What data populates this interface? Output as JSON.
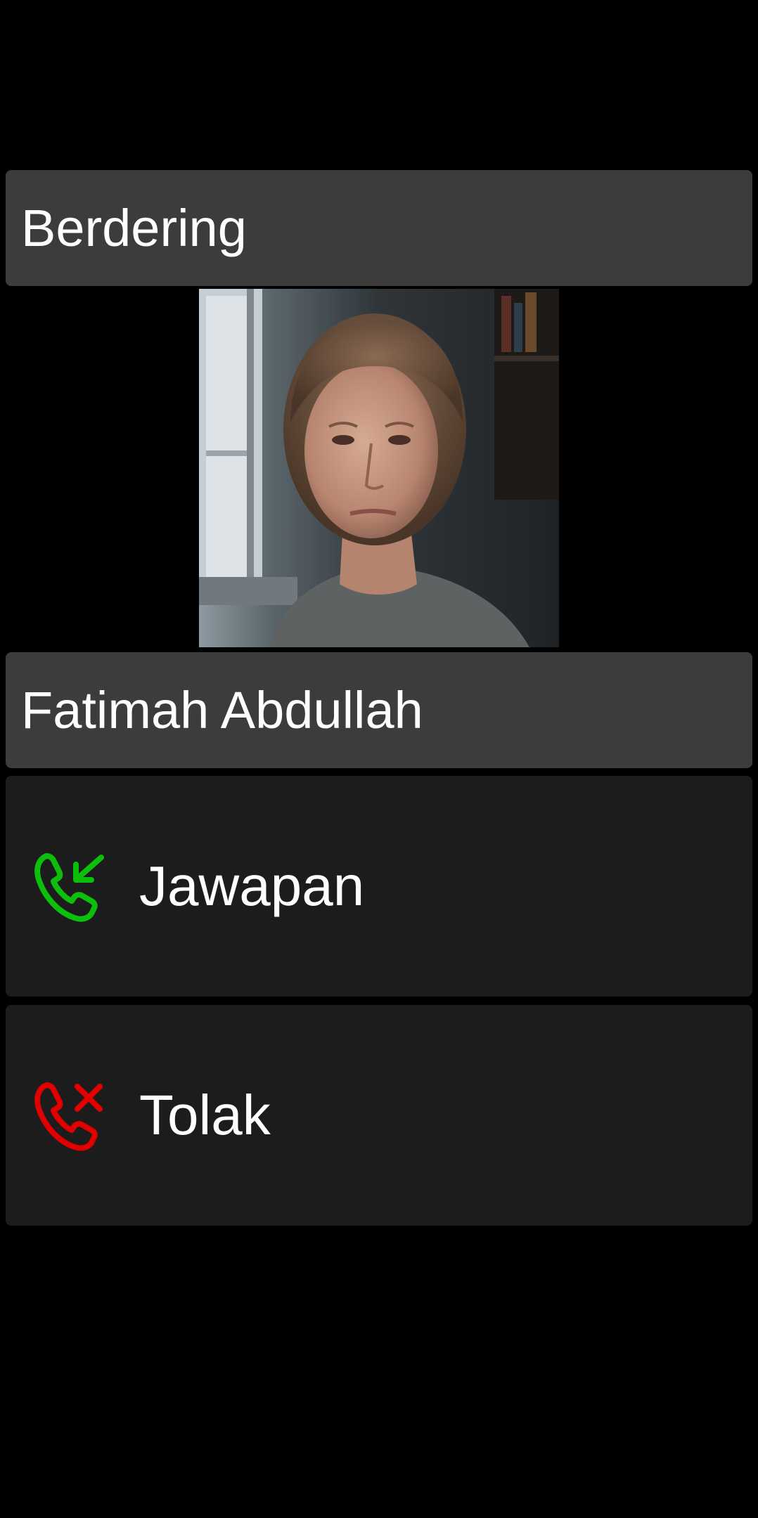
{
  "call": {
    "status": "Berdering",
    "caller_name": "Fatimah Abdullah"
  },
  "actions": {
    "answer": {
      "label": "Jawapan",
      "icon": "phone-incoming-icon",
      "color": "#0dbf0d"
    },
    "reject": {
      "label": "Tolak",
      "icon": "phone-decline-icon",
      "color": "#e00000"
    }
  },
  "colors": {
    "background": "#000000",
    "header_bar": "#3c3c3c",
    "action_button": "#1c1c1c",
    "text": "#ffffff"
  }
}
